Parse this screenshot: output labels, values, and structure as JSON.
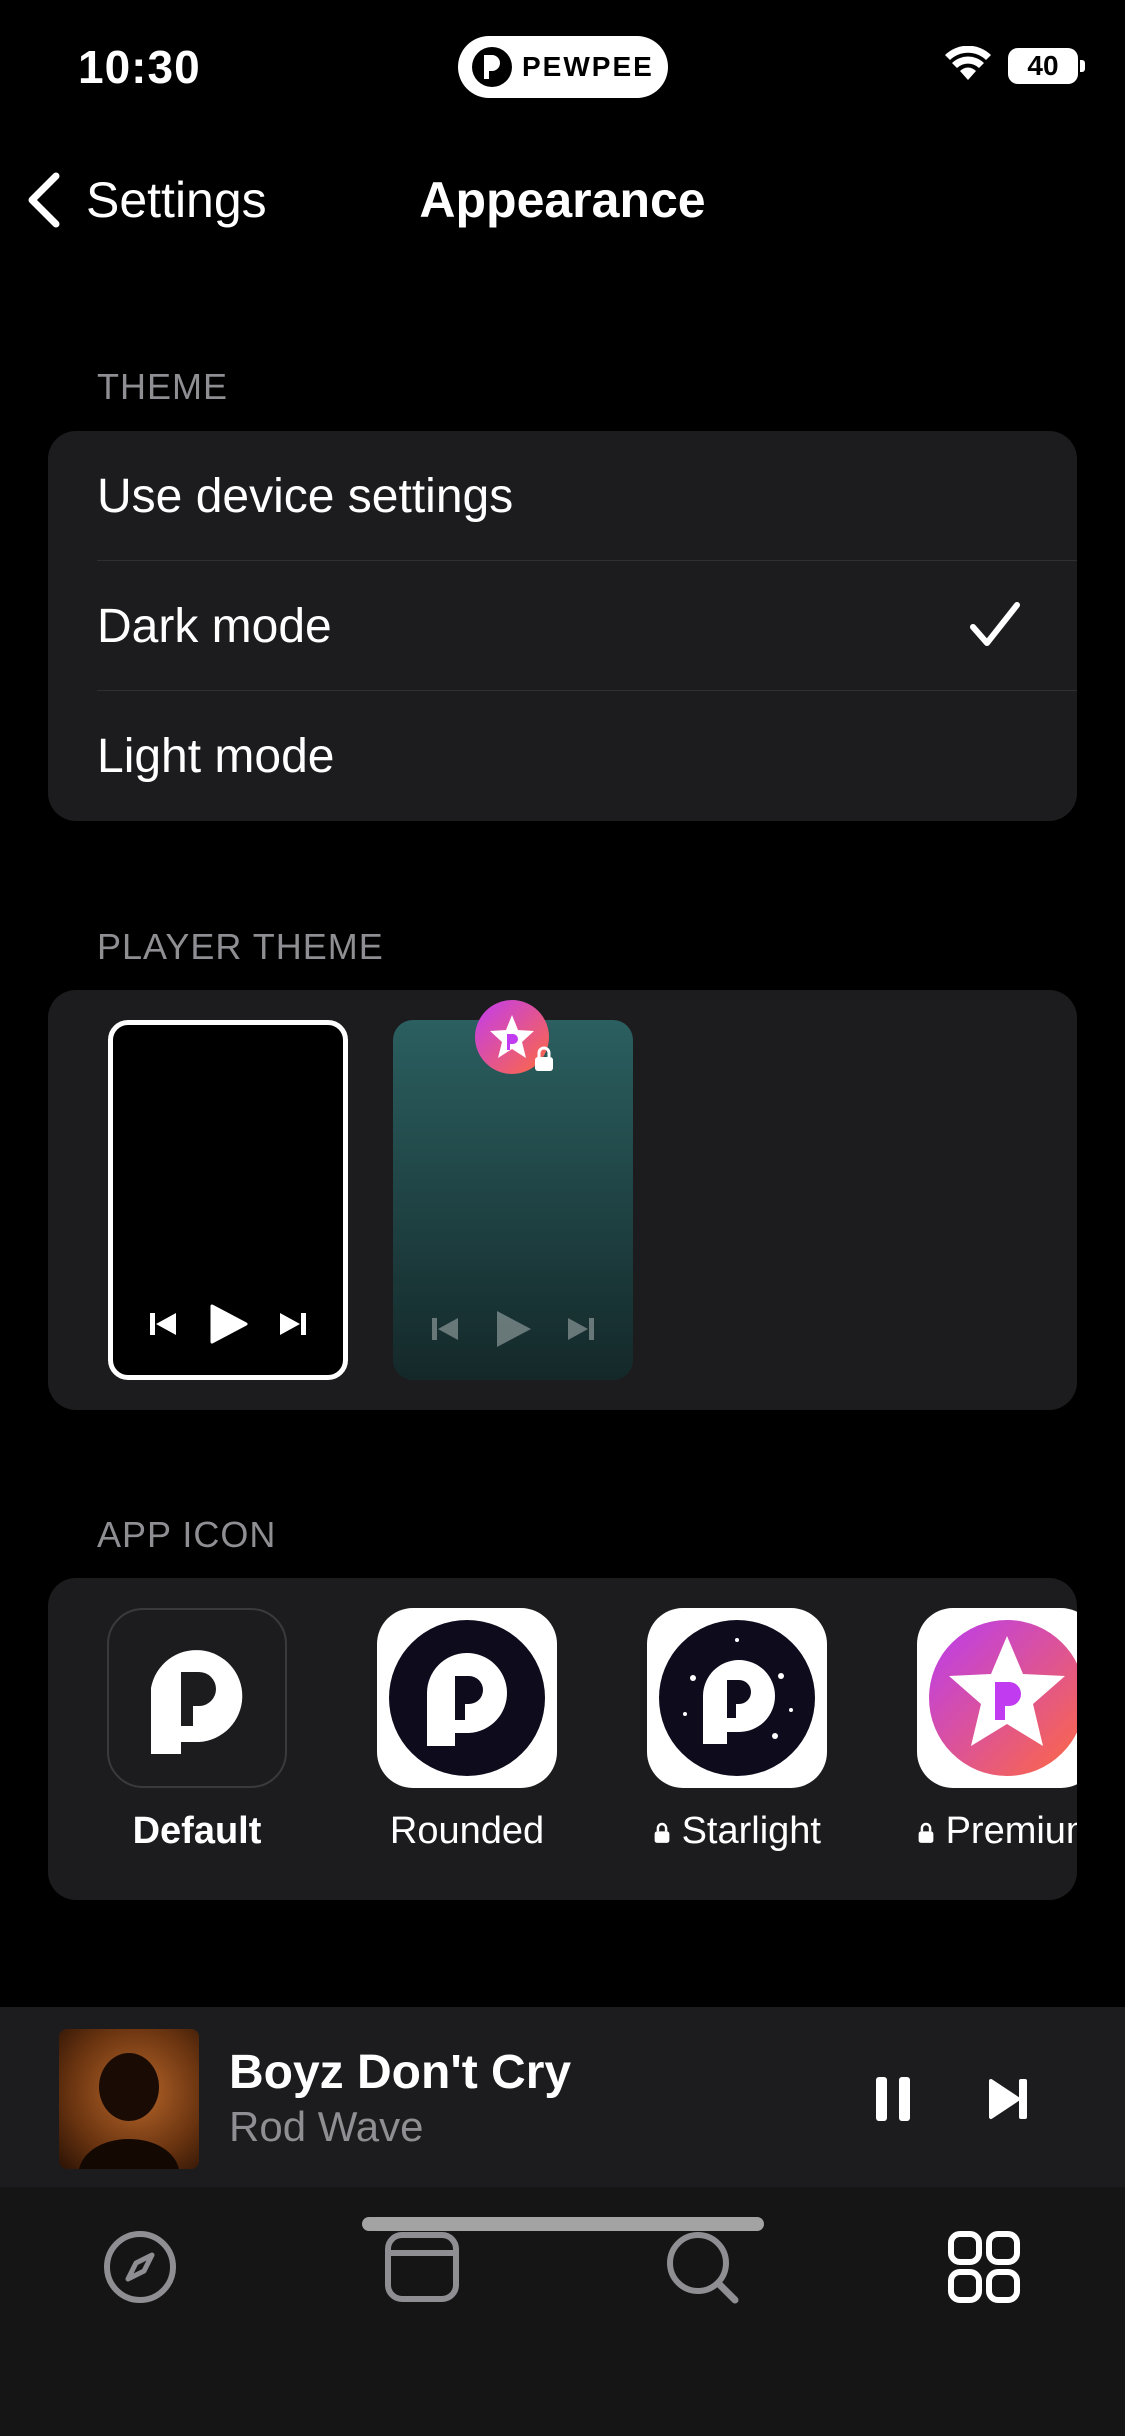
{
  "status_bar": {
    "time": "10:30",
    "app_pill": "PEWPEE",
    "battery": "40"
  },
  "nav": {
    "back_label": "Settings",
    "title": "Appearance"
  },
  "theme": {
    "label": "THEME",
    "options": [
      "Use device settings",
      "Dark mode",
      "Light mode"
    ],
    "selected": "Dark mode"
  },
  "player_theme": {
    "label": "PLAYER THEME",
    "options": [
      "Black",
      "Teal gradient"
    ],
    "selected": "Black"
  },
  "app_icon": {
    "label": "APP ICON",
    "items": [
      {
        "label": "Default",
        "locked": false,
        "selected": true
      },
      {
        "label": "Rounded",
        "locked": false,
        "selected": false
      },
      {
        "label": "Starlight",
        "locked": true,
        "selected": false
      },
      {
        "label": "Premium",
        "locked": true,
        "selected": false
      }
    ]
  },
  "now_playing": {
    "title": "Boyz Don't Cry",
    "artist": "Rod Wave"
  },
  "tabs": [
    "explore-icon",
    "library-icon",
    "search-icon",
    "settings-grid-icon"
  ],
  "colors": {
    "background": "#000000",
    "card": "#1c1c1e",
    "secondary_text": "#8e8e93",
    "accent_gradient": [
      "#c13cf0",
      "#ff6a3d"
    ]
  }
}
